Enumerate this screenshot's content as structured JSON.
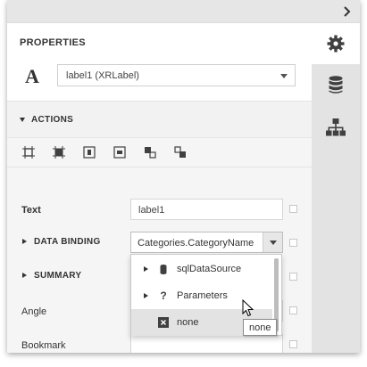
{
  "panel": {
    "title": "PROPERTIES",
    "component_selector": {
      "value": "label1 (XRLabel)",
      "glyph": "A"
    }
  },
  "side_rail": {
    "items": [
      {
        "icon": "gear-icon",
        "active": true
      },
      {
        "icon": "database-icon",
        "active": false
      },
      {
        "icon": "report-explorer-icon",
        "active": false
      }
    ]
  },
  "actions": {
    "header": "ACTIONS",
    "toolbar_icons": [
      "fit-bounds-to-container-icon",
      "fit-bounds-to-text-icon",
      "center-horizontally-icon",
      "center-vertically-icon",
      "bring-to-front-icon",
      "send-to-back-icon"
    ]
  },
  "properties": {
    "text": {
      "label": "Text",
      "value": "label1"
    },
    "data_binding": {
      "label": "DATA BINDING",
      "value": "Categories.CategoryName"
    },
    "summary": {
      "label": "SUMMARY"
    },
    "angle": {
      "label": "Angle"
    },
    "bookmark": {
      "label": "Bookmark"
    }
  },
  "binding_dropdown": {
    "items": [
      {
        "label": "sqlDataSource",
        "icon": "database-icon",
        "expandable": true,
        "hovered": false
      },
      {
        "label": "Parameters",
        "icon": "question-icon",
        "expandable": true,
        "hovered": false
      },
      {
        "label": "none",
        "icon": "none-x-icon",
        "expandable": false,
        "hovered": true
      }
    ]
  },
  "tooltip": {
    "text": "none"
  },
  "colors": {
    "rail_background": "#e3e3e3",
    "hover_background": "#e3e3e3",
    "icon_dark": "#404040"
  }
}
